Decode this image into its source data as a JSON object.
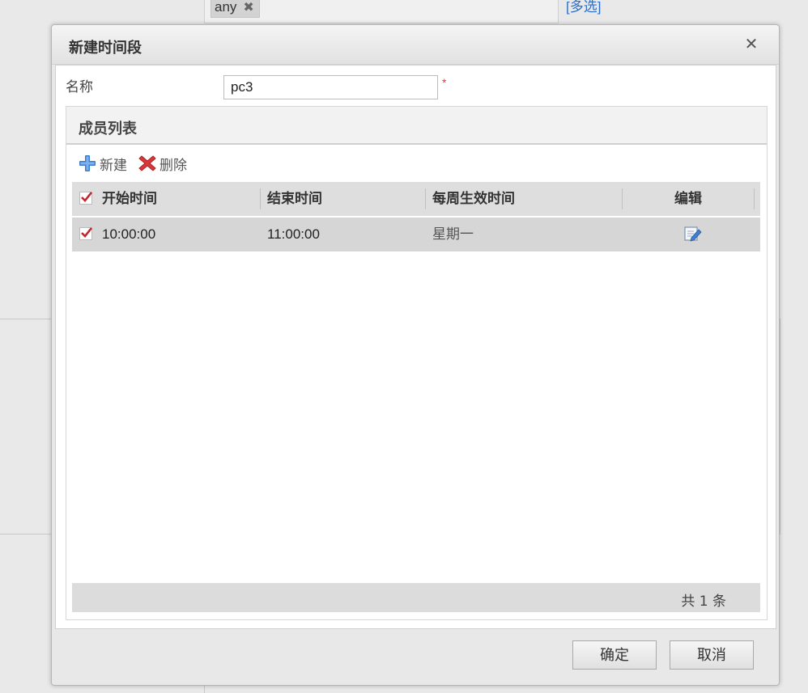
{
  "background": {
    "tag_label": "any",
    "tag_remove_glyph": "✖",
    "link_label": "[多选]"
  },
  "dialog": {
    "title": "新建时间段",
    "close_glyph": "✕",
    "name_label": "名称",
    "name_value": "pc3",
    "required_mark": "*",
    "panel_title": "成员列表",
    "toolbar": {
      "new_label": "新建",
      "delete_label": "删除"
    },
    "grid": {
      "columns": [
        "开始时间",
        "结束时间",
        "每周生效时间",
        "编辑"
      ],
      "rows": [
        {
          "checked": true,
          "start": "10:00:00",
          "end": "11:00:00",
          "weekdays": "星期一",
          "edit_icon": "edit-icon"
        }
      ],
      "footer": "共 1 条"
    },
    "ok_label": "确定",
    "cancel_label": "取消"
  },
  "colors": {
    "required": "#e03a3a",
    "link": "#2a6fc9",
    "check": "#c0282d",
    "add_icon": "#3b7fd4",
    "delete_icon": "#d9383a"
  }
}
